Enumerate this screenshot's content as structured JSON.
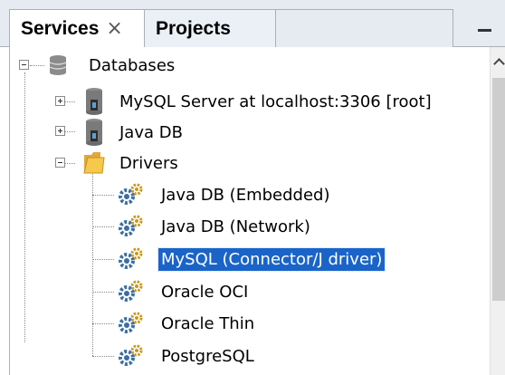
{
  "tabs": [
    {
      "label": "Services",
      "close": "×",
      "active": true
    },
    {
      "label": "Projects",
      "active": false
    }
  ],
  "tree": {
    "root": {
      "label": "Databases",
      "icon": "database-icon",
      "expanded": true
    },
    "items": [
      {
        "label": "MySQL Server at localhost:3306 [root]",
        "icon": "server-icon",
        "expanded": false
      },
      {
        "label": "Java DB",
        "icon": "server-icon",
        "expanded": false
      },
      {
        "label": "Drivers",
        "icon": "folder-icon",
        "expanded": true,
        "children": [
          {
            "label": "Java DB (Embedded)",
            "icon": "driver-gear-icon"
          },
          {
            "label": "Java DB (Network)",
            "icon": "driver-gear-icon"
          },
          {
            "label": "MySQL (Connector/J driver)",
            "icon": "driver-gear-icon",
            "selected": true
          },
          {
            "label": "Oracle OCI",
            "icon": "driver-gear-icon"
          },
          {
            "label": "Oracle Thin",
            "icon": "driver-gear-icon"
          },
          {
            "label": "PostgreSQL",
            "icon": "driver-gear-icon"
          }
        ]
      }
    ]
  },
  "colors": {
    "selection": "#1a64c8",
    "tab_strip": "#e5ebf1",
    "border": "#a9b1b8"
  }
}
